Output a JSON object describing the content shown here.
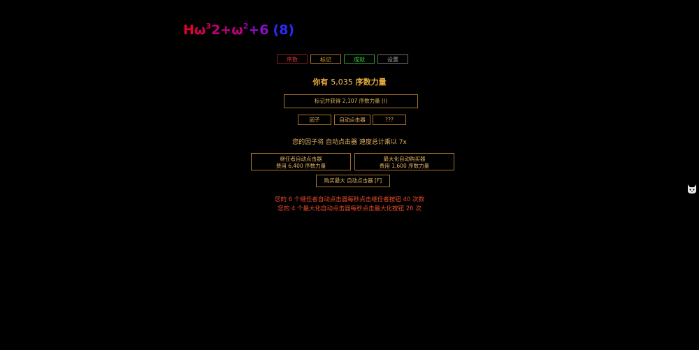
{
  "ordinal": {
    "h": "H",
    "omega": "ω",
    "exp3": "3",
    "two_plus": "2+ω",
    "exp2": "2",
    "plus6": "+6",
    "base": "(8)"
  },
  "tabs": {
    "ordinal": "序数",
    "markup": "标记",
    "achievements": "成就",
    "settings": "设置"
  },
  "power": {
    "prefix": "你有",
    "amount": "5,035",
    "suffix": "序数力量"
  },
  "markup_button": "标记并获得 2,107 序数力量 (I)",
  "subtabs": {
    "factors": "因子",
    "autoclickers": "自动点击器",
    "unknown": "???"
  },
  "factor_text": "您的因子将 自动点击器 速度总计乘以 7x",
  "succ_autoclicker": {
    "title": "继任者自动点击器",
    "cost": "费用 6,400 序数力量"
  },
  "max_autoclicker": {
    "title": "最大化自动购买器",
    "cost": "费用 1,600 序数力量"
  },
  "buy_max": "购买最大 自动点击器 [F]",
  "status": {
    "line1": "您的 6 个继任者自动点击器每秒点击继任者按钮 40 次数",
    "line2": "您的 4 个最大化自动点击器每秒点击最大化按钮 26 次"
  },
  "icons": {
    "corner": "cat-icon"
  }
}
